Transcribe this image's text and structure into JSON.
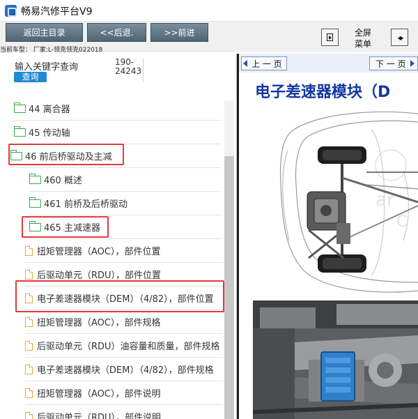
{
  "window": {
    "title": "畅易汽修平台V9"
  },
  "toolbar": {
    "home_label": "返回主目录",
    "back_label": "<<后退.",
    "forward_label": ">>前进",
    "fullscreen_label_line1": "全屏",
    "fullscreen_label_line2": "菜单"
  },
  "vehicle": {
    "line": "当前车型：  厂家:L-领克领克022018"
  },
  "search": {
    "label": "输入关键字查询",
    "button": "查询",
    "code_line1": "190-",
    "code_line2": "24243"
  },
  "tree": {
    "items": [
      {
        "label": "44 离合器",
        "icon": "folder-icon"
      },
      {
        "label": "45 传动轴",
        "icon": "folder-icon"
      },
      {
        "label": "46 前后桥驱动及主减",
        "icon": "folder-icon"
      },
      {
        "label": "460 概述",
        "icon": "folder-icon"
      },
      {
        "label": "461 前桥及后桥驱动",
        "icon": "folder-icon"
      },
      {
        "label": "465 主减速器",
        "icon": "folder-icon"
      },
      {
        "label": "扭矩管理器（AOC），部件位置",
        "icon": "document-icon"
      },
      {
        "label": "后驱动单元（RDU），部件位置",
        "icon": "document-icon"
      },
      {
        "label": "电子差速器模块（DEM）（4/82），部件位置",
        "icon": "document-icon"
      },
      {
        "label": "扭矩管理器（AOC），部件规格",
        "icon": "document-icon"
      },
      {
        "label": "后驱动单元（RDU）油容量和质量，部件规格",
        "icon": "document-icon"
      },
      {
        "label": "电子差速器模块（DEM）（4/82），部件规格",
        "icon": "document-icon"
      },
      {
        "label": "扭矩管理器（AOC），部件说明",
        "icon": "document-icon"
      },
      {
        "label": "后驱动单元（RDU），部件说明",
        "icon": "document-icon"
      }
    ]
  },
  "document": {
    "prev_label": "上 一 页",
    "next_label": "下 一 页",
    "title": "电子差速器模块（D"
  },
  "colors": {
    "nav_button": "#5f7483",
    "search_button": "#1f8ad6",
    "folder": "#3aa648",
    "document": "#f0a63c",
    "highlight": "#e23b3b",
    "doc_title": "#1438a3"
  }
}
